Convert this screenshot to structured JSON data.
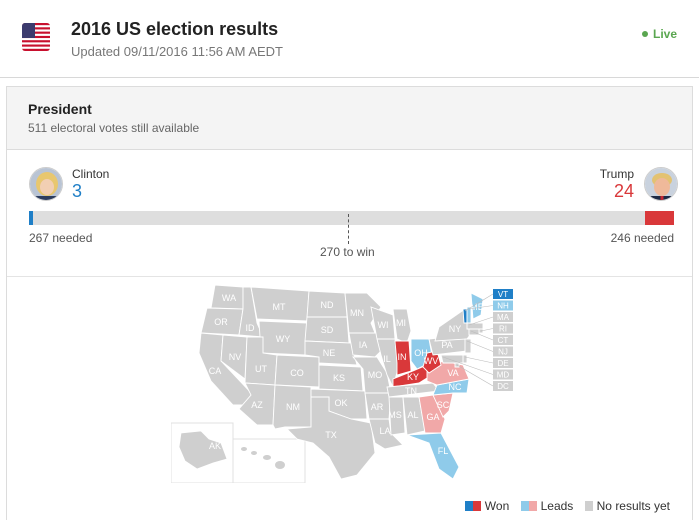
{
  "header": {
    "title": "2016 US election results",
    "updated": "Updated 09/11/2016 11:56 AM AEDT",
    "live_label": "Live"
  },
  "section": {
    "title": "President",
    "subtitle": "511 electoral votes still available"
  },
  "candidates": {
    "dem": {
      "name": "Clinton",
      "votes": "3",
      "needed": "267 needed",
      "color": "#1f7fc7",
      "bar_share": 0.005556
    },
    "rep": {
      "name": "Trump",
      "votes": "24",
      "needed": "246 needed",
      "color": "#d9383a",
      "bar_share": 0.04444
    }
  },
  "to_win_label": "270 to win",
  "colors": {
    "no_results": "#cfcfcf",
    "dem_won": "#1f7fc7",
    "dem_leads": "#8fcbea",
    "rep_won": "#d9383a",
    "rep_leads": "#f1a8a8",
    "live": "#5aa650"
  },
  "map": {
    "states": {
      "WA": "none",
      "OR": "none",
      "CA": "none",
      "NV": "none",
      "ID": "none",
      "MT": "none",
      "WY": "none",
      "UT": "none",
      "AZ": "none",
      "CO": "none",
      "NM": "none",
      "ND": "none",
      "SD": "none",
      "NE": "none",
      "KS": "none",
      "OK": "none",
      "TX": "none",
      "MN": "none",
      "IA": "none",
      "MO": "none",
      "AR": "none",
      "LA": "none",
      "WI": "none",
      "IL": "none",
      "MI": "none",
      "MS": "none",
      "AL": "none",
      "TN": "none",
      "PA": "none",
      "NY": "none",
      "AK": "none",
      "HI": "none",
      "IN": "rep_won",
      "KY": "rep_won",
      "WV": "rep_won",
      "VA": "rep_leads",
      "SC": "rep_leads",
      "GA": "rep_leads",
      "OH": "dem_leads",
      "NC": "dem_leads",
      "FL": "dem_leads",
      "VT": "dem_won",
      "NH": "dem_leads",
      "ME": "dem_leads",
      "MA": "none",
      "RI": "none",
      "CT": "none",
      "NJ": "none",
      "DE": "none",
      "MD": "none",
      "DC": "none"
    },
    "small_states": [
      "VT",
      "NH",
      "MA",
      "RI",
      "CT",
      "NJ",
      "DE",
      "MD",
      "DC"
    ]
  },
  "legend": {
    "won": "Won",
    "leads": "Leads",
    "no_results": "No results yet"
  }
}
